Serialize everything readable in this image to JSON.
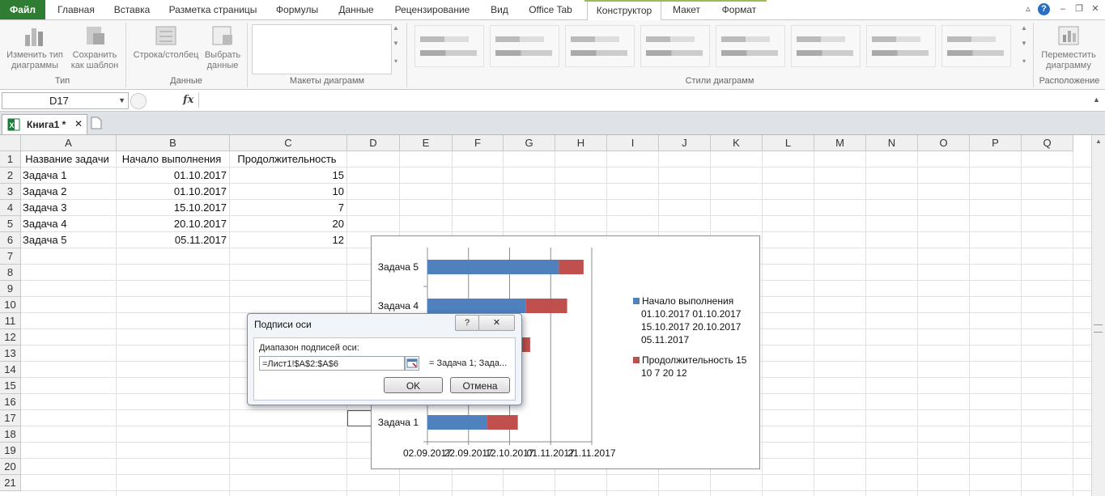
{
  "ribbon_tabs": [
    "Файл",
    "Главная",
    "Вставка",
    "Разметка страницы",
    "Формулы",
    "Данные",
    "Рецензирование",
    "Вид",
    "Office Tab",
    "Конструктор",
    "Макет",
    "Формат"
  ],
  "ribbon": {
    "change_type": "Изменить тип диаграммы",
    "save_template": "Сохранить как шаблон",
    "group_type": "Тип",
    "row_col": "Строка/столбец",
    "select_data": "Выбрать данные",
    "group_data": "Данные",
    "group_layouts": "Макеты диаграмм",
    "group_styles": "Стили диаграмм",
    "move_chart": "Переместить диаграмму",
    "group_location": "Расположение"
  },
  "formula_bar": {
    "name_box": "D17",
    "fx": "fx",
    "formula": ""
  },
  "workbook_tab": "Книга1 *",
  "sheet": {
    "columns": [
      "A",
      "B",
      "C",
      "D",
      "E",
      "F",
      "G",
      "H",
      "I",
      "J",
      "K",
      "L",
      "M",
      "N",
      "O",
      "P",
      "Q"
    ],
    "rows": [
      "1",
      "2",
      "3",
      "4",
      "5",
      "6",
      "7",
      "8",
      "9",
      "10",
      "11",
      "12",
      "13",
      "14",
      "15",
      "16",
      "17",
      "18",
      "19",
      "20",
      "21"
    ],
    "header": [
      "Название задачи",
      "Начало выполнения",
      "Продолжительность"
    ],
    "data": [
      [
        "Задача 1",
        "01.10.2017",
        "15"
      ],
      [
        "Задача 2",
        "01.10.2017",
        "10"
      ],
      [
        "Задача 3",
        "15.10.2017",
        "7"
      ],
      [
        "Задача 4",
        "20.10.2017",
        "20"
      ],
      [
        "Задача 5",
        "05.11.2017",
        "12"
      ]
    ]
  },
  "chart_data": {
    "type": "bar",
    "orientation": "horizontal",
    "stacked": true,
    "categories": [
      "Задача 1",
      "Задача 2",
      "Задача 3",
      "Задача 4",
      "Задача 5"
    ],
    "visible_category_labels": [
      "Задача 1",
      "Задача 4",
      "Задача 5"
    ],
    "series": [
      {
        "name": "Начало выполнения 01.10.2017 01.10.2017 15.10.2017 20.10.2017 05.11.2017",
        "values": [
          "01.10.2017",
          "01.10.2017",
          "15.10.2017",
          "20.10.2017",
          "05.11.2017"
        ],
        "color": "#4f81bd"
      },
      {
        "name": "Продолжительность 15 10 7 20 12",
        "values": [
          15,
          10,
          7,
          20,
          12
        ],
        "color": "#c0504d"
      }
    ],
    "x_ticks": [
      "02.09.2017",
      "22.09.2017",
      "12.10.2017",
      "01.11.2017",
      "21.11.2017"
    ],
    "xlim": [
      "02.09.2017",
      "21.11.2017"
    ],
    "legend_lines": [
      [
        "Начало выполнения",
        "01.10.2017 01.10.2017",
        "15.10.2017 20.10.2017",
        "05.11.2017"
      ],
      [
        "Продолжительность 15",
        "10 7 20 12"
      ]
    ],
    "legend_position": "right",
    "grid": "vertical"
  },
  "dialog": {
    "title": "Подписи оси",
    "help": "?",
    "close": "✕",
    "field_label": "Диапазон подписей оси:",
    "field_value": "=Лист1!$A$2:$A$6",
    "preview": "= Задача 1; Зада...",
    "ok": "OK",
    "cancel": "Отмена"
  }
}
